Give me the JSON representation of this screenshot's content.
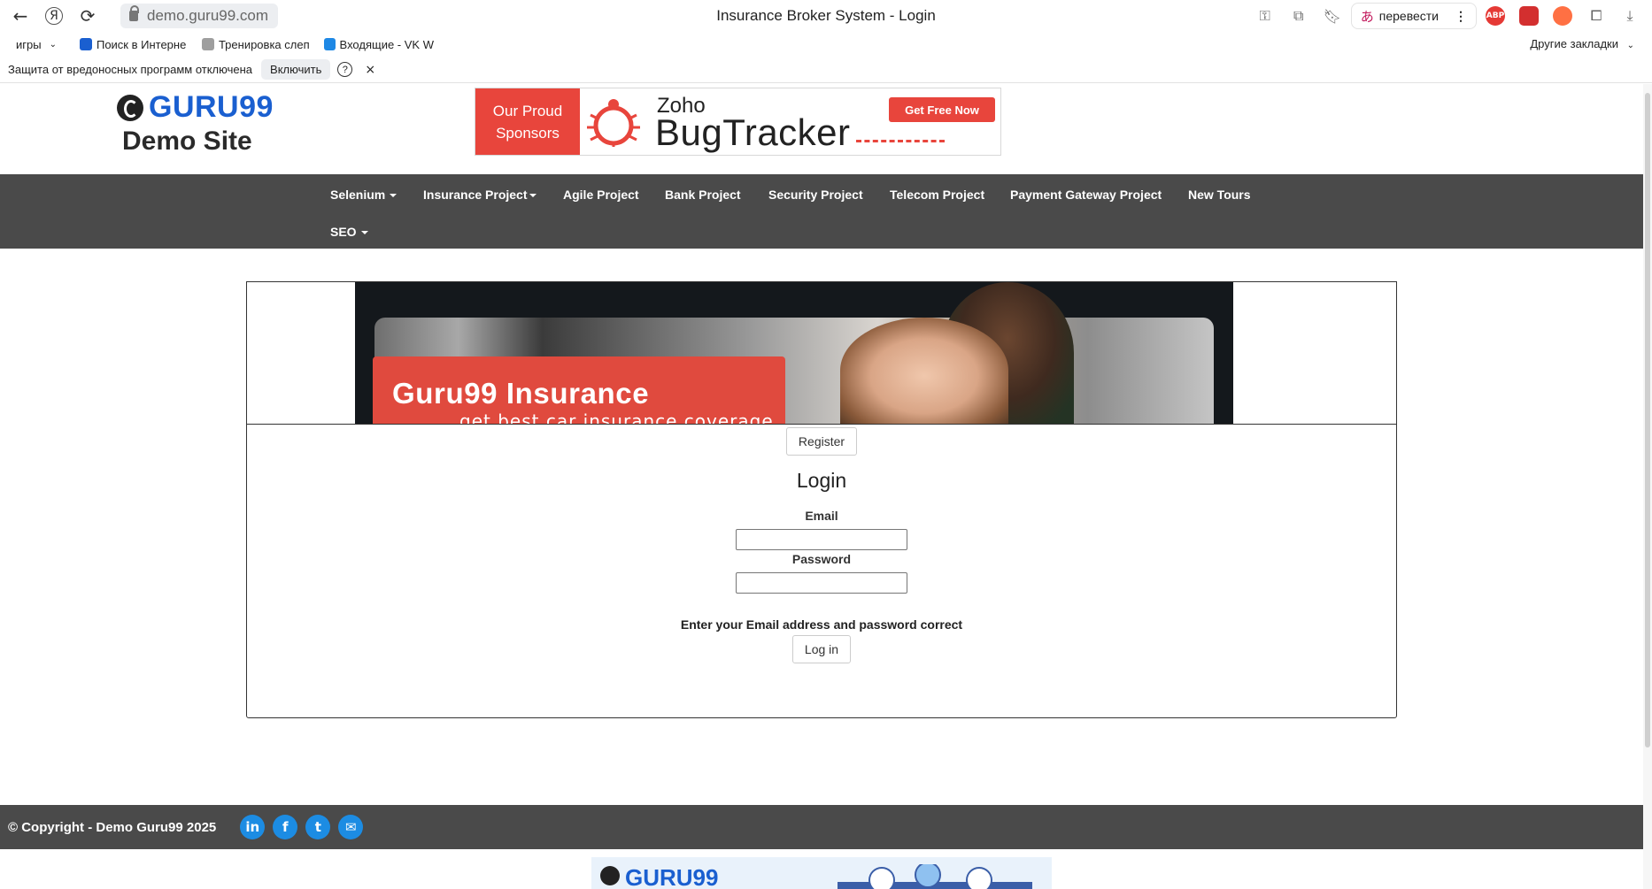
{
  "browser": {
    "url": "demo.guru99.com",
    "tab_title": "Insurance Broker System - Login",
    "translate_label": "перевести",
    "back_icon": "←",
    "yandex_icon": "Я",
    "reload_icon": "⟳",
    "menu_icon": "⋮",
    "download_icon": "⤓"
  },
  "bookmarks": {
    "items": [
      {
        "label": "игры",
        "color": "#ffffff"
      },
      {
        "label": "Поиск в Интерне",
        "color": "#1a5fd0"
      },
      {
        "label": "Тренировка слеп",
        "color": "#9e9e9e"
      },
      {
        "label": "Входящие - VK W",
        "color": "#1e88e5"
      }
    ],
    "other_label": "Другие закладки"
  },
  "infobar": {
    "message": "Защита от вредоносных программ отключена",
    "enable_label": "Включить",
    "help_label": "?",
    "close_label": "×"
  },
  "site": {
    "logo_text": "GURU99",
    "logo_sub": "Demo Site"
  },
  "ad": {
    "left_line1": "Our Proud",
    "left_line2": "Sponsors",
    "brand": "Zoho",
    "product": "BugTracker",
    "cta": "Get Free Now"
  },
  "nav": {
    "items": [
      {
        "label": "Selenium",
        "dropdown": true
      },
      {
        "label": "Insurance Project",
        "dropdown": true
      },
      {
        "label": "Agile Project",
        "dropdown": false
      },
      {
        "label": "Bank Project",
        "dropdown": false
      },
      {
        "label": "Security Project",
        "dropdown": false
      },
      {
        "label": "Telecom Project",
        "dropdown": false
      },
      {
        "label": "Payment Gateway Project",
        "dropdown": false
      },
      {
        "label": "New Tours",
        "dropdown": false
      },
      {
        "label": "SEO",
        "dropdown": true
      }
    ]
  },
  "banner": {
    "title": "Guru99 Insurance",
    "subtitle": "get best car insurance coverage"
  },
  "form": {
    "register_label": "Register",
    "heading": "Login",
    "email_label": "Email",
    "email_value": "",
    "password_label": "Password",
    "password_value": "",
    "message": "Enter your Email address and password correct",
    "login_label": "Log in"
  },
  "footer": {
    "copyright": "© Copyright - Demo Guru99 2025",
    "social": [
      {
        "name": "linkedin-icon",
        "glyph": "in"
      },
      {
        "name": "facebook-icon",
        "glyph": "f"
      },
      {
        "name": "twitter-icon",
        "glyph": "t"
      },
      {
        "name": "email-icon",
        "glyph": "✉"
      }
    ]
  },
  "bottom_ad": {
    "logo_text": "GURU99"
  },
  "colors": {
    "navbar": "#4a4a4a",
    "brand_blue": "#1a5fd0",
    "ad_red": "#e8453c",
    "social_blue": "#1c8ce3"
  }
}
